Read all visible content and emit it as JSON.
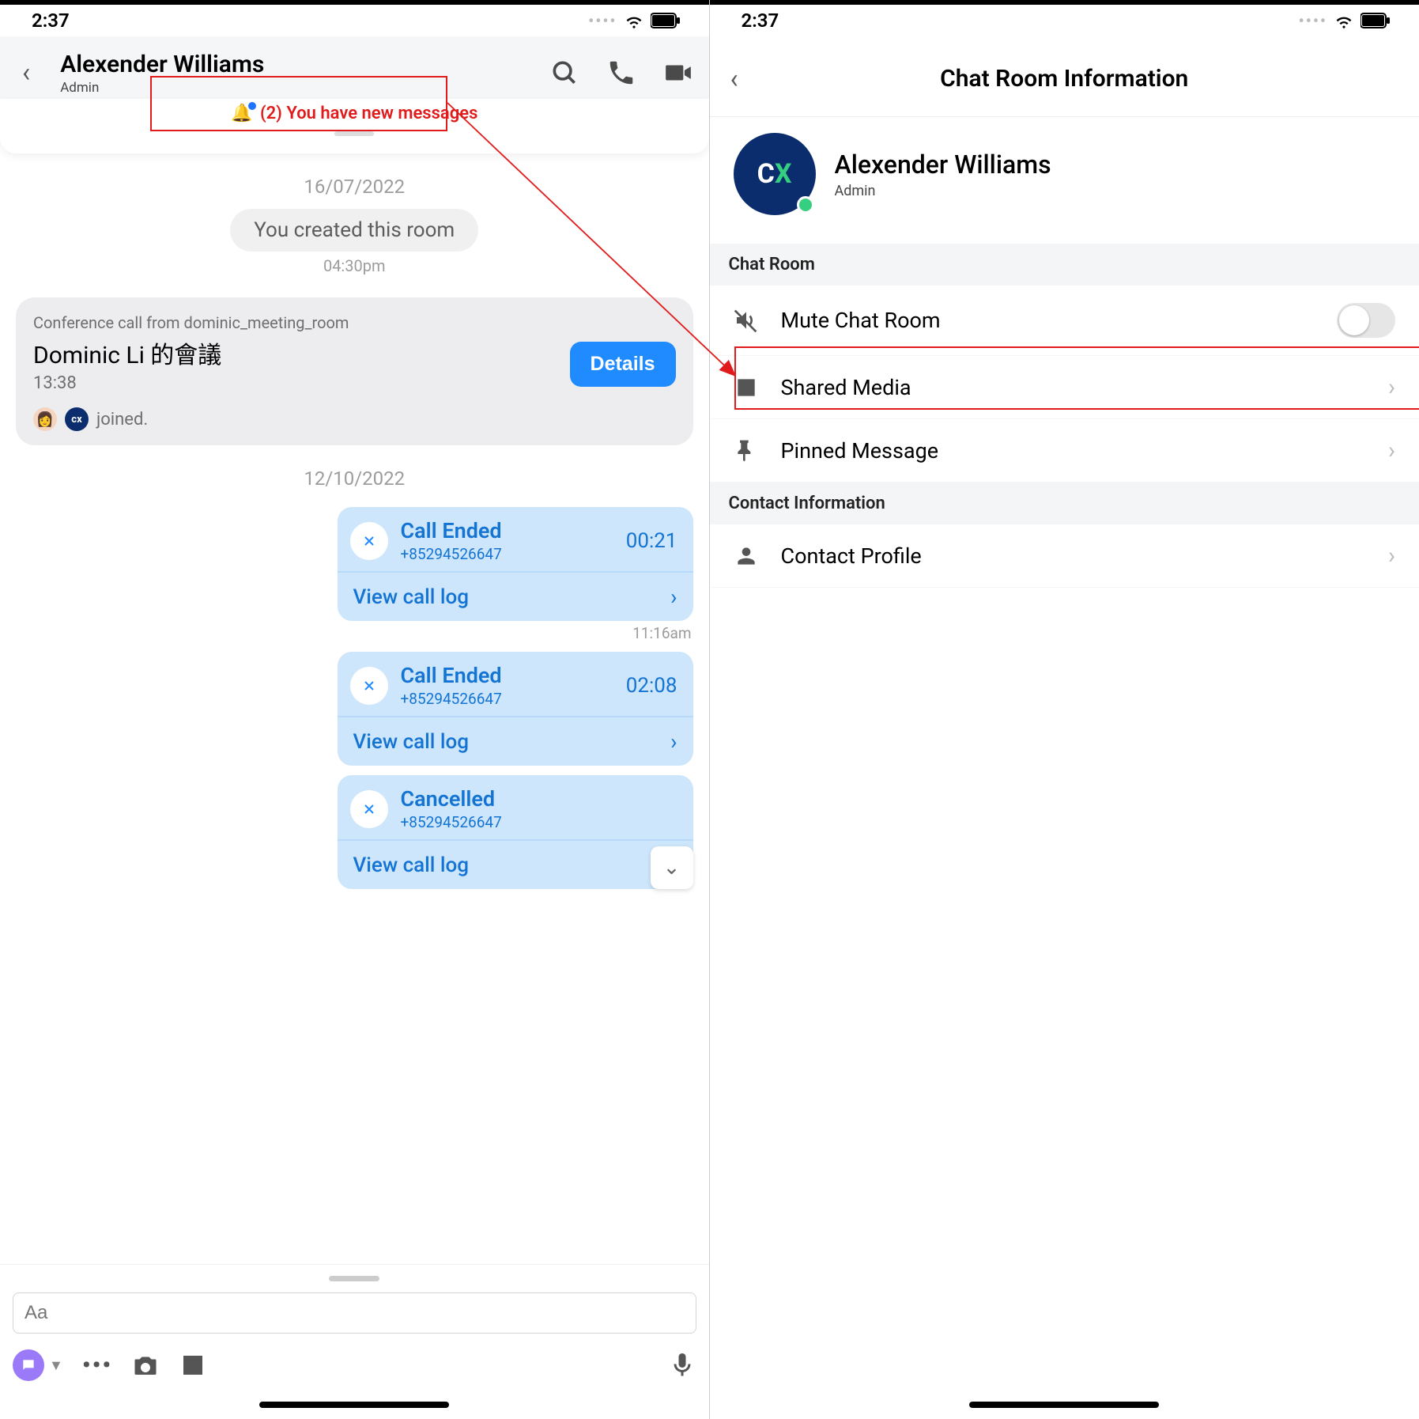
{
  "status": {
    "time": "2:37",
    "dots": "••••"
  },
  "chat_header": {
    "name": "Alexender Williams",
    "role": "Admin"
  },
  "banner": "(2) You have new messages",
  "date1": "16/07/2022",
  "created_text": "You created this room",
  "created_time": "04:30pm",
  "conf": {
    "meta": "Conference call from dominic_meeting_room",
    "title": "Dominic Li 的會議",
    "time": "13:38",
    "details": "Details",
    "joined": "joined.",
    "avatar_cx": "cx"
  },
  "date2": "12/10/2022",
  "calls": [
    {
      "title": "Call Ended",
      "number": "+85294526647",
      "duration": "00:21",
      "log": "View call log",
      "time": "11:16am"
    },
    {
      "title": "Call Ended",
      "number": "+85294526647",
      "duration": "02:08",
      "log": "View call log"
    },
    {
      "title": "Cancelled",
      "number": "+85294526647",
      "log": "View call log"
    }
  ],
  "composer": {
    "placeholder": "Aa"
  },
  "info": {
    "title": "Chat Room Information",
    "name": "Alexender Williams",
    "role": "Admin",
    "section1": "Chat Room",
    "mute": "Mute Chat Room",
    "media": "Shared Media",
    "pinned": "Pinned Message",
    "section2": "Contact Information",
    "profile": "Contact Profile"
  }
}
